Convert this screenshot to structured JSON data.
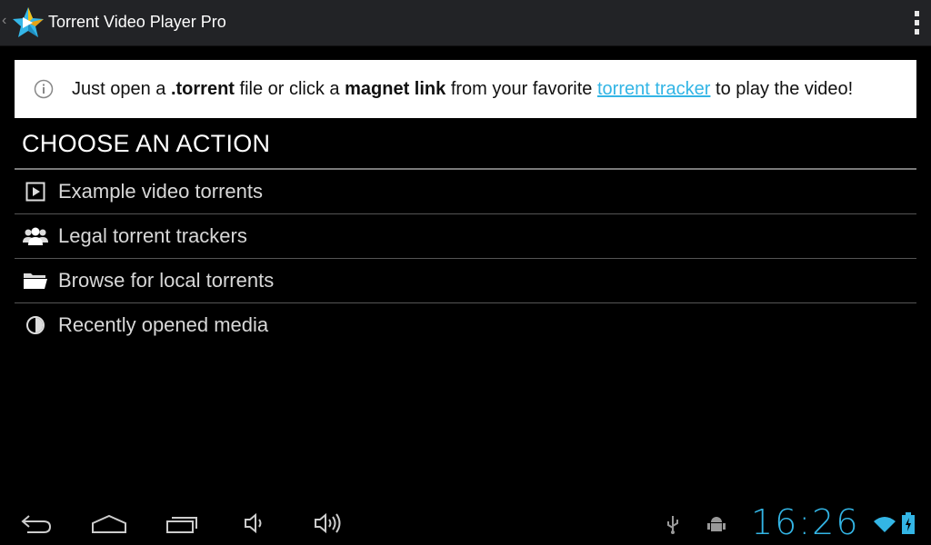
{
  "app": {
    "title": "Torrent Video Player Pro",
    "icon": "star-app-icon",
    "up_caret": "‹"
  },
  "info": {
    "icon": "info-icon",
    "parts": {
      "p1": "Just open a ",
      "b1": ".torrent",
      "p2": " file or click a ",
      "b2": "magnet link",
      "p3": " from your favorite ",
      "link": "torrent tracker",
      "p4": " to play the video!"
    }
  },
  "section": {
    "header": "CHOOSE AN ACTION"
  },
  "actions": [
    {
      "label": "Example video torrents",
      "icon": "play-icon"
    },
    {
      "label": "Legal torrent trackers",
      "icon": "people-icon"
    },
    {
      "label": "Browse for local torrents",
      "icon": "folder-icon"
    },
    {
      "label": "Recently opened media",
      "icon": "history-icon"
    }
  ],
  "status": {
    "time": "16:26",
    "icons": [
      "usb-icon",
      "android-debug-icon",
      "wifi-icon",
      "battery-charging-icon"
    ]
  },
  "nav": {
    "buttons": [
      "back-icon",
      "home-icon",
      "recent-apps-icon",
      "volume-down-icon",
      "volume-up-icon"
    ]
  },
  "colors": {
    "accent": "#33b5e5",
    "action_bar": "#222326",
    "background": "#000000"
  }
}
